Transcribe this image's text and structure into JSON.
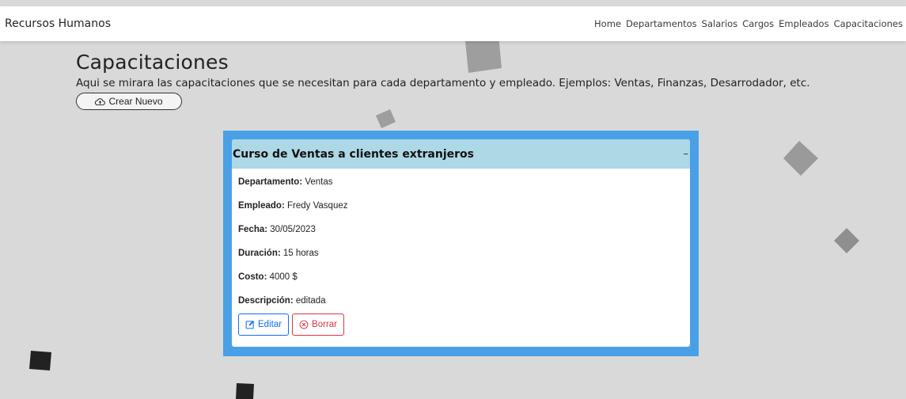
{
  "navbar": {
    "brand": "Recursos Humanos",
    "links": [
      "Home",
      "Departamentos",
      "Salarios",
      "Cargos",
      "Empleados",
      "Capacitaciones"
    ]
  },
  "page": {
    "title": "Capacitaciones",
    "description": "Aqui se mirara las capacitaciones que se necesitan para cada departamento y empleado. Ejemplos: Ventas, Finanzas, Desarrodador, etc.",
    "create_label": "Crear Nuevo"
  },
  "card": {
    "title": "Curso de Ventas a clientes extranjeros",
    "collapse_symbol": "–",
    "fields": [
      {
        "label": "Departamento:",
        "value": "Ventas"
      },
      {
        "label": "Empleado:",
        "value": "Fredy Vasquez"
      },
      {
        "label": "Fecha:",
        "value": "30/05/2023"
      },
      {
        "label": "Duración:",
        "value": "15 horas"
      },
      {
        "label": "Costo:",
        "value": "4000 $"
      },
      {
        "label": "Descripción:",
        "value": "editada"
      }
    ],
    "edit_label": "Editar",
    "delete_label": "Borrar"
  },
  "colors": {
    "background": "#d9d9d9",
    "card_frame": "#4aa0e6",
    "card_header": "#add8e6",
    "edit": "#0d6efd",
    "delete": "#dc3545"
  }
}
